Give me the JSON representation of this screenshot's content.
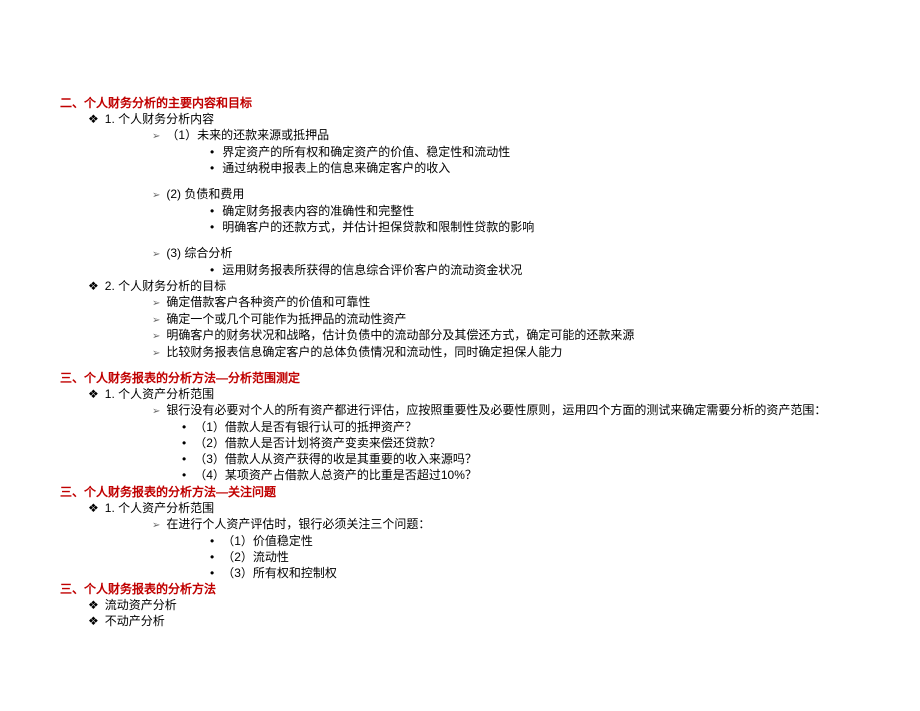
{
  "sections": [
    {
      "title": "二、个人财务分析的主要内容和目标",
      "items": [
        {
          "text": "1. 个人财务分析内容",
          "children": [
            {
              "text": "（1）未来的还款来源或抵押品",
              "children": [
                {
                  "text": "界定资产的所有权和确定资产的价值、稳定性和流动性"
                },
                {
                  "text": "通过纳税申报表上的信息来确定客户的收入"
                }
              ]
            },
            {
              "text": "(2) 负债和费用",
              "children": [
                {
                  "text": "确定财务报表内容的准确性和完整性"
                },
                {
                  "text": "明确客户的还款方式，并估计担保贷款和限制性贷款的影响"
                }
              ]
            },
            {
              "text": "(3) 综合分析",
              "children": [
                {
                  "text": "运用财务报表所获得的信息综合评价客户的流动资金状况"
                }
              ]
            }
          ]
        },
        {
          "text": "2. 个人财务分析的目标",
          "children": [
            {
              "text": "确定借款客户各种资产的价值和可靠性"
            },
            {
              "text": "确定一个或几个可能作为抵押品的流动性资产"
            },
            {
              "text": "明确客户的财务状况和战略，估计负债中的流动部分及其偿还方式，确定可能的还款来源"
            },
            {
              "text": "比较财务报表信息确定客户的总体负债情况和流动性，同时确定担保人能力"
            }
          ]
        }
      ]
    },
    {
      "title": "三、个人财务报表的分析方法—分析范围测定",
      "items": [
        {
          "text": "1. 个人资产分析范围",
          "children": [
            {
              "text": "银行没有必要对个人的所有资产都进行评估，应按照重要性及必要性原则，运用四个方面的测试来确定需要分析的资产范围：",
              "children": [
                {
                  "text": "（1）借款人是否有银行认可的抵押资产？"
                },
                {
                  "text": "（2）借款人是否计划将资产变卖来偿还贷款？"
                },
                {
                  "text": "（3）借款人从资产获得的收是其重要的收入来源吗？"
                },
                {
                  "text": "（4）某项资产占借款人总资产的比重是否超过10%？"
                }
              ]
            }
          ]
        }
      ]
    },
    {
      "title": "三、个人财务报表的分析方法—关注问题",
      "items": [
        {
          "text": "1. 个人资产分析范围",
          "children": [
            {
              "text": "在进行个人资产评估时，银行必须关注三个问题：",
              "children": [
                {
                  "text": "（1）价值稳定性"
                },
                {
                  "text": "（2）流动性"
                },
                {
                  "text": "（3）所有权和控制权"
                }
              ]
            }
          ]
        }
      ]
    },
    {
      "title": "三、个人财务报表的分析方法",
      "items": [
        {
          "text": "流动资产分析"
        },
        {
          "text": "不动产分析"
        }
      ]
    }
  ]
}
